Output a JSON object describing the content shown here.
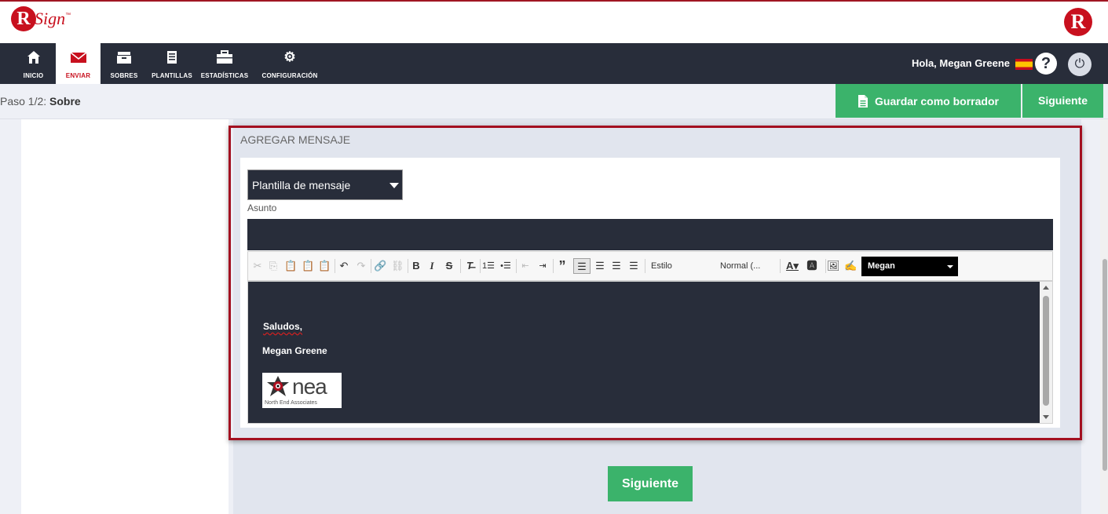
{
  "brand": {
    "logo_letter": "R",
    "logo_text": "Sign",
    "logo_tm": "™",
    "right_logo_letter": "R",
    "accent_color": "#c8101e",
    "green_color": "#3bb36b",
    "dark_color": "#282d3a"
  },
  "nav": {
    "items": [
      {
        "label": "INICIO",
        "icon": "home-icon"
      },
      {
        "label": "ENVIAR",
        "icon": "envelope-icon",
        "active": true
      },
      {
        "label": "SOBRES",
        "icon": "inbox-icon"
      },
      {
        "label": "PLANTILLAS",
        "icon": "document-icon"
      },
      {
        "label": "ESTADÍSTICAS",
        "icon": "briefcase-icon"
      },
      {
        "label": "CONFIGURACIÓN",
        "icon": "gear-icon"
      }
    ],
    "greeting": "Hola, Megan Greene",
    "help_icon": "?",
    "power_icon": "⏻"
  },
  "step": {
    "prefix": "Paso 1/2:",
    "name": "Sobre"
  },
  "actions": {
    "draft_label": "Guardar como borrador",
    "next_label": "Siguiente"
  },
  "message": {
    "header": "AGREGAR MENSAJE",
    "template_select": "Plantilla de mensaje",
    "subject_label": "Asunto",
    "subject_value": "",
    "toolbar": {
      "style_label": "Estilo",
      "format_label": "Normal (...",
      "font_name": "Megan"
    },
    "body": {
      "greeting": "Saludos,",
      "name": "Megan Greene",
      "logo_text": "nea",
      "logo_subtext": "North End Associates"
    }
  },
  "bottom": {
    "next_label": "Siguiente"
  }
}
